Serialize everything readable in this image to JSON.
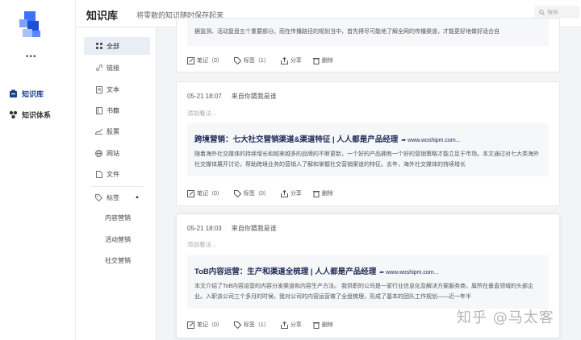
{
  "rail": {
    "items": [
      {
        "label": "知识库",
        "icon": "knowledge-base-icon",
        "active": true
      },
      {
        "label": "知识体系",
        "icon": "knowledge-system-icon",
        "active": false
      }
    ],
    "more": "•••"
  },
  "header": {
    "title": "知识库",
    "subtitle": "将零散的知识随时保存起来",
    "search_placeholder": "搜索"
  },
  "categories": [
    {
      "label": "全部",
      "icon": "grid-icon",
      "active": true
    },
    {
      "label": "链接",
      "icon": "link-icon"
    },
    {
      "label": "文本",
      "icon": "text-icon"
    },
    {
      "label": "书籍",
      "icon": "book-icon"
    },
    {
      "label": "股票",
      "icon": "stock-icon"
    },
    {
      "label": "网站",
      "icon": "globe-icon"
    },
    {
      "label": "文件",
      "icon": "file-icon"
    },
    {
      "label": "标签",
      "icon": "tag-icon",
      "expanded": true
    }
  ],
  "tags": [
    "内容营销",
    "活动营销",
    "社交营销"
  ],
  "cards": [
    {
      "excerpt_text": "据监测、活动复盘五个重要部分。而在传播路径的规划当中，首先得尽可能地了解全网的传播渠道，才能更好地做好适合自",
      "actions": {
        "note": "笔记（0）",
        "tag": "标签（1）",
        "share": "分享",
        "delete": "删除"
      }
    },
    {
      "time": "05-21 18:07",
      "source": "来自你猜我是谁",
      "note_placeholder": "添加看法...",
      "title": "跨境营销：七大社交营销渠道&渠道特征 | 人人都是产品经理",
      "link": "www.woshipm.com...",
      "excerpt_text": "随着海外社交媒体的持续增长和越来越多的品牌的不断更新，一个好的产品拥有一个好的营销策略才能立足于市场。本文通过对七大类海外社交媒体展开讨论，帮助跨境业务的营销人了解和掌握社交营销渠道的特征。去年，海外社交媒体的持续增长",
      "actions": {
        "note": "笔记（0）",
        "tag": "标签（0）",
        "share": "分享",
        "delete": "删除"
      }
    },
    {
      "time": "05-21 18:03",
      "source": "来自你猜我是谁",
      "note_placeholder": "添加看法...",
      "title": "ToB内容运营：生产和渠道全梳理 | 人人都是产品经理",
      "link": "www.woshipm.com...",
      "excerpt_text": "本文介绍了ToB内容运营的内容分发渠道和内容生产方法。 我供职的公司是一家行业信息化及解决方案服务商，属所在垂直领域的头部企业。入职该公司三个多月的时候，我对公司的内容运营做了全盘梳理，形成了基本的团队工作规划——近一年半",
      "actions": {
        "note": "笔记（0）",
        "tag": "标签（1）",
        "share": "分享",
        "delete": "删除"
      }
    }
  ],
  "watermark": "知乎 @马太客",
  "colors": {
    "accent": "#1f3f8f",
    "avatar_blue": "#2f6bff",
    "title_navy": "#1e2a55"
  }
}
